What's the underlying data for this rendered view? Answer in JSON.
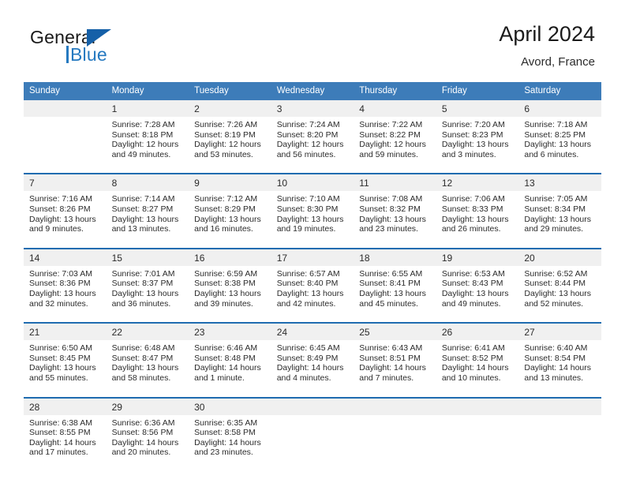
{
  "brand": {
    "line1": "General",
    "line2": "Blue",
    "logo_icon": "triangle-logo-icon"
  },
  "header": {
    "title": "April 2024",
    "subtitle": "Avord, France"
  },
  "colors": {
    "header_blue": "#3d7cb9",
    "separator_blue": "#1f6cb0",
    "daynum_band": "#f0f0f0",
    "brand_blue": "#2579c0",
    "text": "#2b2b2b"
  },
  "weekday_headers": [
    "Sunday",
    "Monday",
    "Tuesday",
    "Wednesday",
    "Thursday",
    "Friday",
    "Saturday"
  ],
  "labels": {
    "sunrise_prefix": "Sunrise:",
    "sunset_prefix": "Sunset:",
    "daylight_prefix": "Daylight:"
  },
  "weeks": [
    {
      "days": [
        {
          "num": "",
          "sunrise": "",
          "sunset": "",
          "daylight1": "",
          "daylight2": ""
        },
        {
          "num": "1",
          "sunrise": "Sunrise: 7:28 AM",
          "sunset": "Sunset: 8:18 PM",
          "daylight1": "Daylight: 12 hours",
          "daylight2": "and 49 minutes."
        },
        {
          "num": "2",
          "sunrise": "Sunrise: 7:26 AM",
          "sunset": "Sunset: 8:19 PM",
          "daylight1": "Daylight: 12 hours",
          "daylight2": "and 53 minutes."
        },
        {
          "num": "3",
          "sunrise": "Sunrise: 7:24 AM",
          "sunset": "Sunset: 8:20 PM",
          "daylight1": "Daylight: 12 hours",
          "daylight2": "and 56 minutes."
        },
        {
          "num": "4",
          "sunrise": "Sunrise: 7:22 AM",
          "sunset": "Sunset: 8:22 PM",
          "daylight1": "Daylight: 12 hours",
          "daylight2": "and 59 minutes."
        },
        {
          "num": "5",
          "sunrise": "Sunrise: 7:20 AM",
          "sunset": "Sunset: 8:23 PM",
          "daylight1": "Daylight: 13 hours",
          "daylight2": "and 3 minutes."
        },
        {
          "num": "6",
          "sunrise": "Sunrise: 7:18 AM",
          "sunset": "Sunset: 8:25 PM",
          "daylight1": "Daylight: 13 hours",
          "daylight2": "and 6 minutes."
        }
      ]
    },
    {
      "days": [
        {
          "num": "7",
          "sunrise": "Sunrise: 7:16 AM",
          "sunset": "Sunset: 8:26 PM",
          "daylight1": "Daylight: 13 hours",
          "daylight2": "and 9 minutes."
        },
        {
          "num": "8",
          "sunrise": "Sunrise: 7:14 AM",
          "sunset": "Sunset: 8:27 PM",
          "daylight1": "Daylight: 13 hours",
          "daylight2": "and 13 minutes."
        },
        {
          "num": "9",
          "sunrise": "Sunrise: 7:12 AM",
          "sunset": "Sunset: 8:29 PM",
          "daylight1": "Daylight: 13 hours",
          "daylight2": "and 16 minutes."
        },
        {
          "num": "10",
          "sunrise": "Sunrise: 7:10 AM",
          "sunset": "Sunset: 8:30 PM",
          "daylight1": "Daylight: 13 hours",
          "daylight2": "and 19 minutes."
        },
        {
          "num": "11",
          "sunrise": "Sunrise: 7:08 AM",
          "sunset": "Sunset: 8:32 PM",
          "daylight1": "Daylight: 13 hours",
          "daylight2": "and 23 minutes."
        },
        {
          "num": "12",
          "sunrise": "Sunrise: 7:06 AM",
          "sunset": "Sunset: 8:33 PM",
          "daylight1": "Daylight: 13 hours",
          "daylight2": "and 26 minutes."
        },
        {
          "num": "13",
          "sunrise": "Sunrise: 7:05 AM",
          "sunset": "Sunset: 8:34 PM",
          "daylight1": "Daylight: 13 hours",
          "daylight2": "and 29 minutes."
        }
      ]
    },
    {
      "days": [
        {
          "num": "14",
          "sunrise": "Sunrise: 7:03 AM",
          "sunset": "Sunset: 8:36 PM",
          "daylight1": "Daylight: 13 hours",
          "daylight2": "and 32 minutes."
        },
        {
          "num": "15",
          "sunrise": "Sunrise: 7:01 AM",
          "sunset": "Sunset: 8:37 PM",
          "daylight1": "Daylight: 13 hours",
          "daylight2": "and 36 minutes."
        },
        {
          "num": "16",
          "sunrise": "Sunrise: 6:59 AM",
          "sunset": "Sunset: 8:38 PM",
          "daylight1": "Daylight: 13 hours",
          "daylight2": "and 39 minutes."
        },
        {
          "num": "17",
          "sunrise": "Sunrise: 6:57 AM",
          "sunset": "Sunset: 8:40 PM",
          "daylight1": "Daylight: 13 hours",
          "daylight2": "and 42 minutes."
        },
        {
          "num": "18",
          "sunrise": "Sunrise: 6:55 AM",
          "sunset": "Sunset: 8:41 PM",
          "daylight1": "Daylight: 13 hours",
          "daylight2": "and 45 minutes."
        },
        {
          "num": "19",
          "sunrise": "Sunrise: 6:53 AM",
          "sunset": "Sunset: 8:43 PM",
          "daylight1": "Daylight: 13 hours",
          "daylight2": "and 49 minutes."
        },
        {
          "num": "20",
          "sunrise": "Sunrise: 6:52 AM",
          "sunset": "Sunset: 8:44 PM",
          "daylight1": "Daylight: 13 hours",
          "daylight2": "and 52 minutes."
        }
      ]
    },
    {
      "days": [
        {
          "num": "21",
          "sunrise": "Sunrise: 6:50 AM",
          "sunset": "Sunset: 8:45 PM",
          "daylight1": "Daylight: 13 hours",
          "daylight2": "and 55 minutes."
        },
        {
          "num": "22",
          "sunrise": "Sunrise: 6:48 AM",
          "sunset": "Sunset: 8:47 PM",
          "daylight1": "Daylight: 13 hours",
          "daylight2": "and 58 minutes."
        },
        {
          "num": "23",
          "sunrise": "Sunrise: 6:46 AM",
          "sunset": "Sunset: 8:48 PM",
          "daylight1": "Daylight: 14 hours",
          "daylight2": "and 1 minute."
        },
        {
          "num": "24",
          "sunrise": "Sunrise: 6:45 AM",
          "sunset": "Sunset: 8:49 PM",
          "daylight1": "Daylight: 14 hours",
          "daylight2": "and 4 minutes."
        },
        {
          "num": "25",
          "sunrise": "Sunrise: 6:43 AM",
          "sunset": "Sunset: 8:51 PM",
          "daylight1": "Daylight: 14 hours",
          "daylight2": "and 7 minutes."
        },
        {
          "num": "26",
          "sunrise": "Sunrise: 6:41 AM",
          "sunset": "Sunset: 8:52 PM",
          "daylight1": "Daylight: 14 hours",
          "daylight2": "and 10 minutes."
        },
        {
          "num": "27",
          "sunrise": "Sunrise: 6:40 AM",
          "sunset": "Sunset: 8:54 PM",
          "daylight1": "Daylight: 14 hours",
          "daylight2": "and 13 minutes."
        }
      ]
    },
    {
      "days": [
        {
          "num": "28",
          "sunrise": "Sunrise: 6:38 AM",
          "sunset": "Sunset: 8:55 PM",
          "daylight1": "Daylight: 14 hours",
          "daylight2": "and 17 minutes."
        },
        {
          "num": "29",
          "sunrise": "Sunrise: 6:36 AM",
          "sunset": "Sunset: 8:56 PM",
          "daylight1": "Daylight: 14 hours",
          "daylight2": "and 20 minutes."
        },
        {
          "num": "30",
          "sunrise": "Sunrise: 6:35 AM",
          "sunset": "Sunset: 8:58 PM",
          "daylight1": "Daylight: 14 hours",
          "daylight2": "and 23 minutes."
        },
        {
          "num": "",
          "sunrise": "",
          "sunset": "",
          "daylight1": "",
          "daylight2": ""
        },
        {
          "num": "",
          "sunrise": "",
          "sunset": "",
          "daylight1": "",
          "daylight2": ""
        },
        {
          "num": "",
          "sunrise": "",
          "sunset": "",
          "daylight1": "",
          "daylight2": ""
        },
        {
          "num": "",
          "sunrise": "",
          "sunset": "",
          "daylight1": "",
          "daylight2": ""
        }
      ]
    }
  ]
}
